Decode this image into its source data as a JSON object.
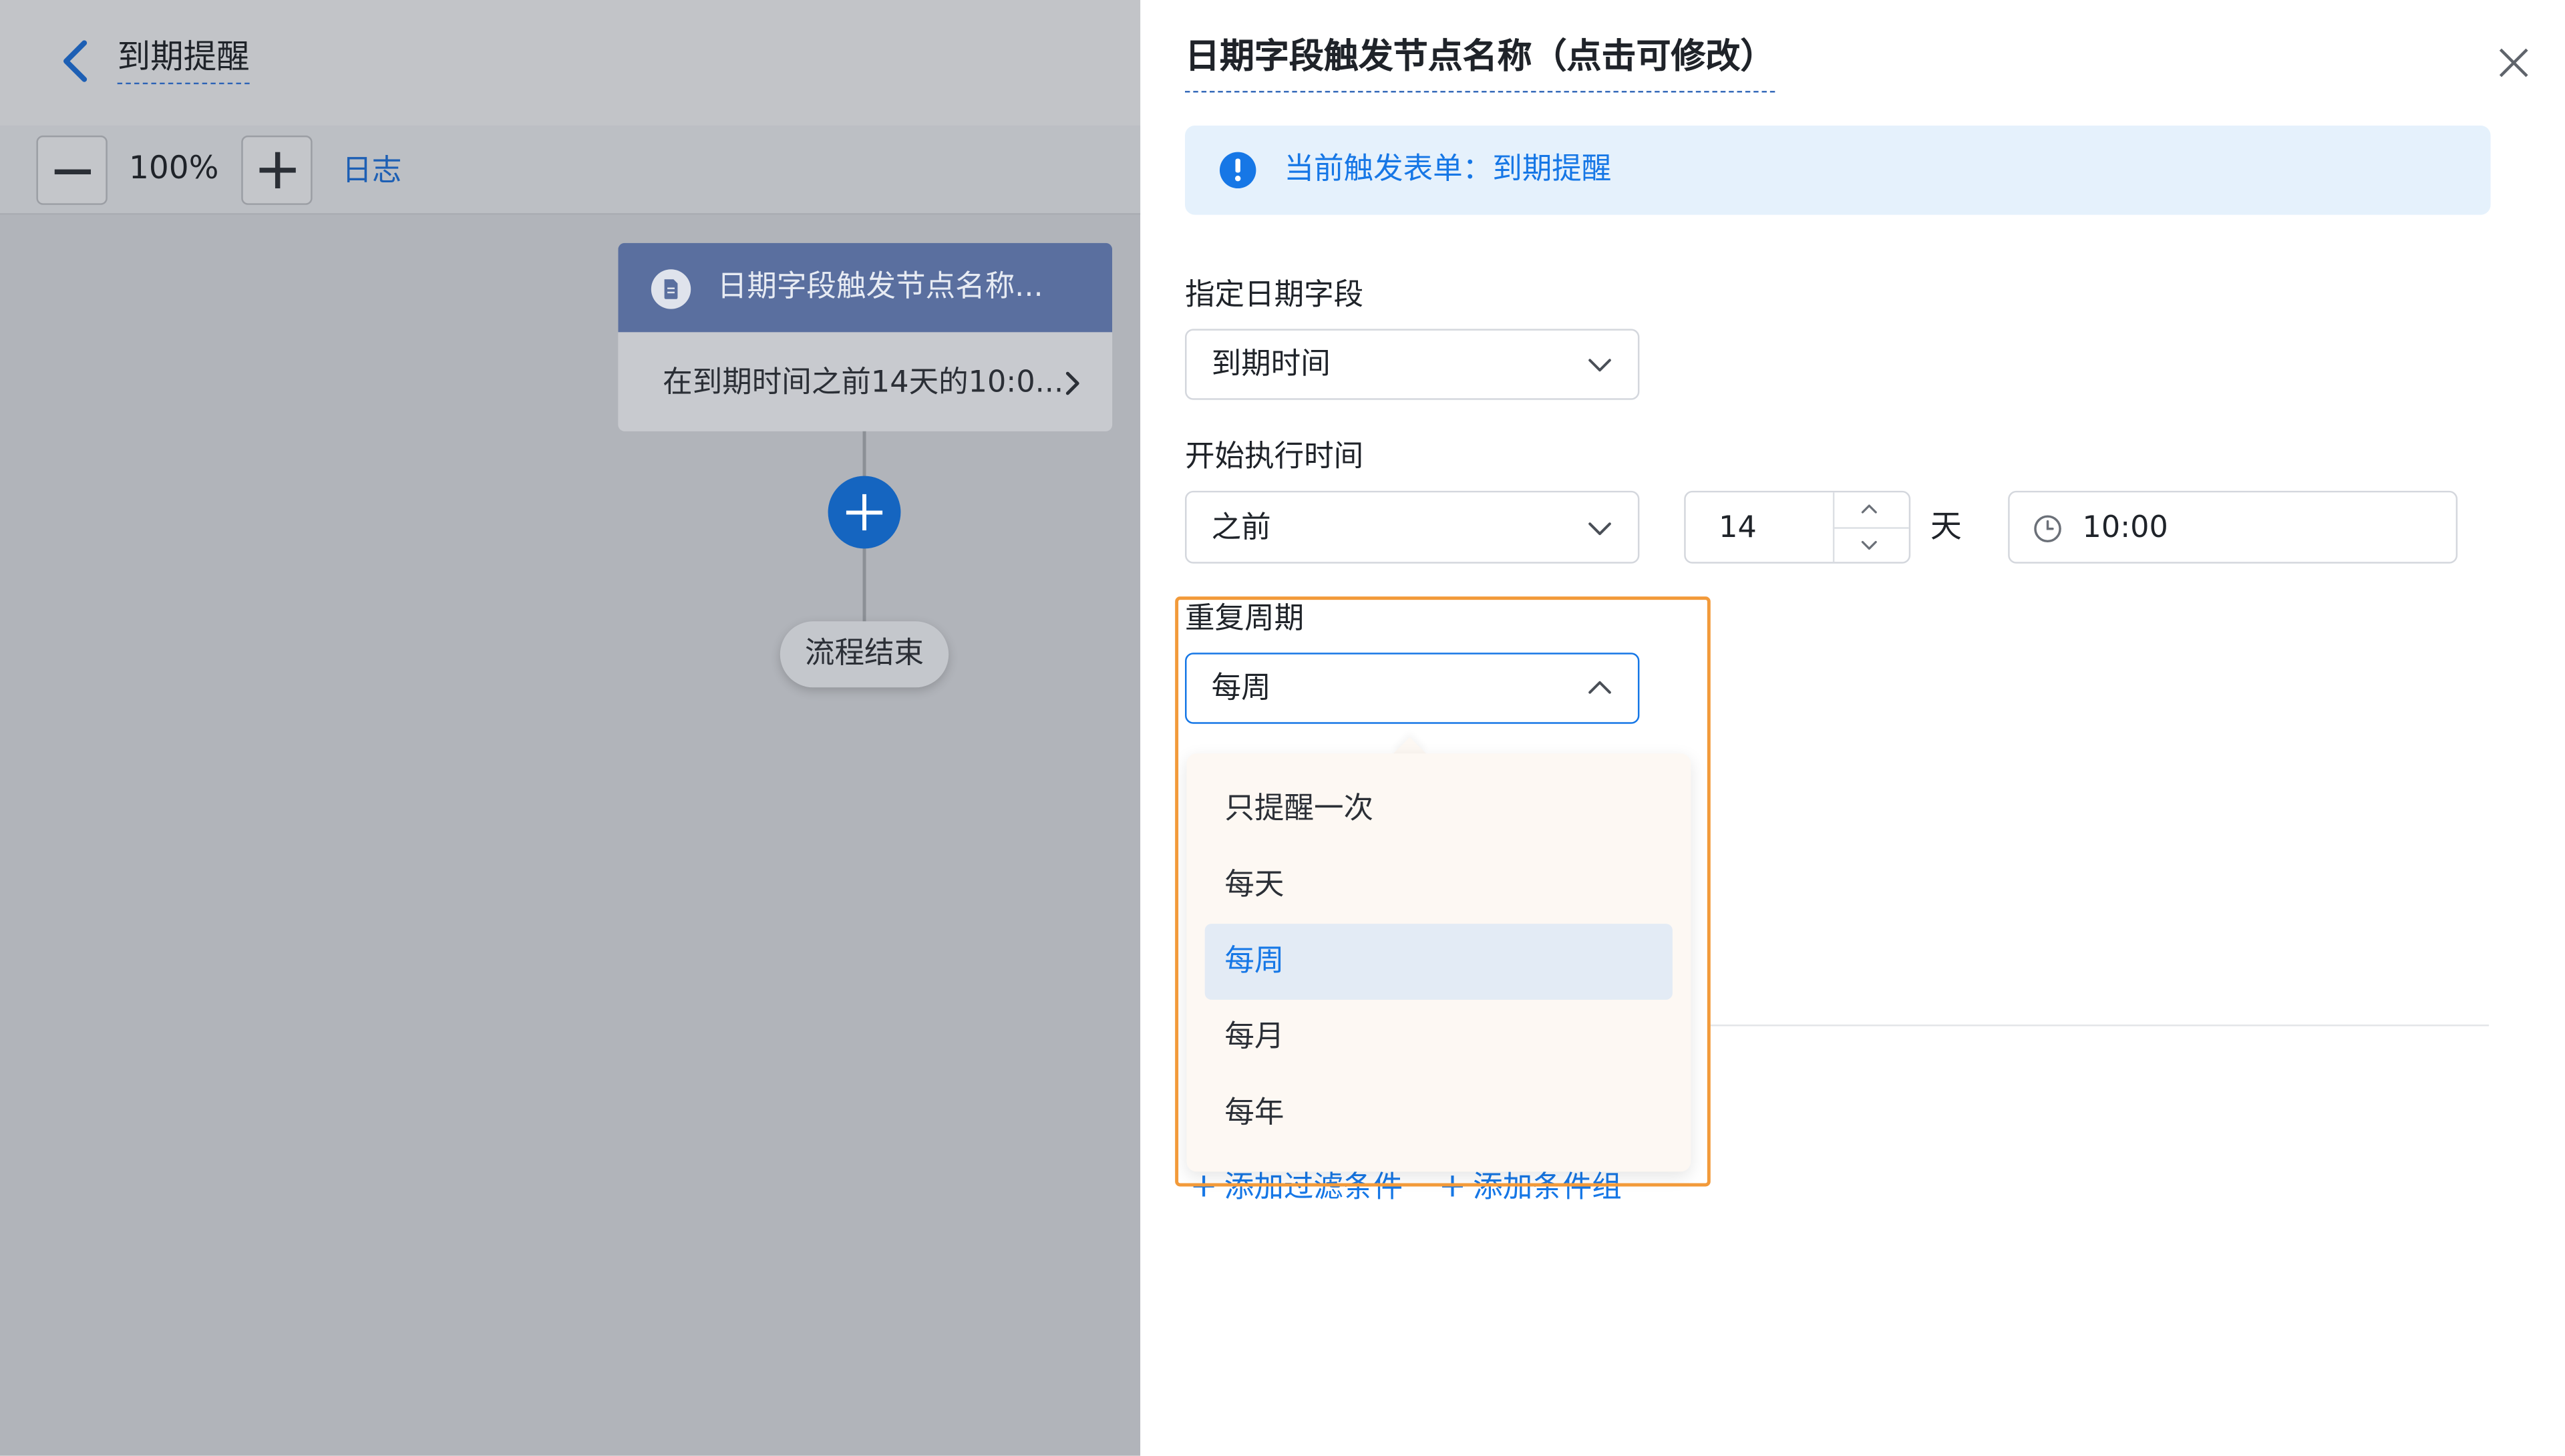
{
  "header": {
    "page_title": "到期提醒",
    "back_icon": "chevron-left-icon"
  },
  "toolbar": {
    "zoom_out_icon": "minus-icon",
    "zoom_level": "100%",
    "zoom_in_icon": "plus-icon",
    "log_link": "日志"
  },
  "flow": {
    "trigger_node": {
      "icon": "document-icon",
      "title": "日期字段触发节点名称...",
      "description": "在到期时间之前14天的10:0...",
      "chevron_icon": "chevron-right-icon"
    },
    "add_node_icon": "plus-circle-icon",
    "end_node_label": "流程结束"
  },
  "panel": {
    "title": "日期字段触发节点名称（点击可修改）",
    "close_icon": "close-icon",
    "info": {
      "icon": "exclamation-icon",
      "text": "当前触发表单：到期提醒"
    },
    "date_field": {
      "label": "指定日期字段",
      "value": "到期时间"
    },
    "start_time": {
      "label": "开始执行时间",
      "direction_value": "之前",
      "days_value": "14",
      "days_unit": "天",
      "time_value": "10:00",
      "clock_icon": "clock-icon"
    },
    "repeat": {
      "label": "重复周期",
      "value": "每周",
      "options": [
        {
          "label": "只提醒一次",
          "selected": false
        },
        {
          "label": "每天",
          "selected": false
        },
        {
          "label": "每周",
          "selected": true
        },
        {
          "label": "每月",
          "selected": false
        },
        {
          "label": "每年",
          "selected": false
        }
      ]
    },
    "filter_links": {
      "add_filter": "添加过滤条件",
      "add_group": "添加条件组"
    }
  },
  "colors": {
    "accent": "#1677e6",
    "highlight_border": "#f29a3a",
    "info_bg": "#e5f1fc"
  }
}
